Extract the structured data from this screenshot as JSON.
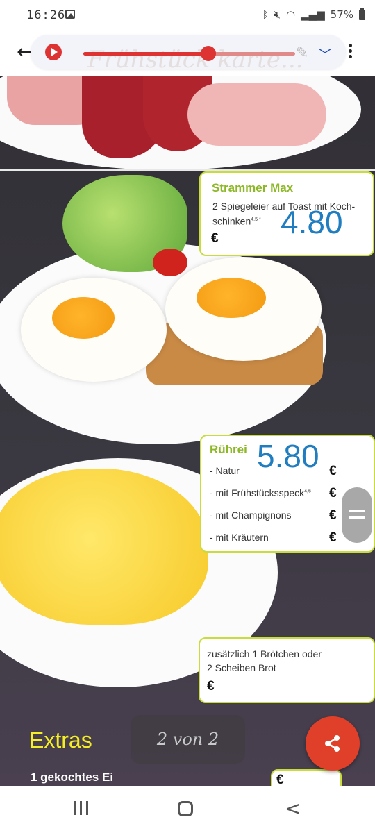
{
  "status_bar": {
    "time": "16:26",
    "battery_text": "57%",
    "icons": [
      "gallery-icon",
      "bluetooth-icon",
      "mute-icon",
      "lock-icon",
      "wifi-icon",
      "signal-icon",
      "battery-icon"
    ]
  },
  "toolbar": {
    "ghost_title": "Frühstück karte...",
    "audio_progress": 0.59,
    "icons": [
      "back-arrow-icon",
      "play-icon",
      "pencil-icon",
      "chevron-down-icon",
      "more-vert-icon"
    ],
    "accent_color": "#d33333"
  },
  "menu": {
    "strammer": {
      "title": "Strammer Max",
      "desc_line1": "2 Spiegeleier auf Toast mit Koch-",
      "desc_line2": "schinken",
      "sup": "4,5 *",
      "price": "4.80",
      "currency": "€"
    },
    "ruehrei": {
      "title": "Rührei",
      "price": "5.80",
      "currency": "€",
      "options": [
        {
          "label": "- Natur",
          "sup": "",
          "currency": "€"
        },
        {
          "label": "- mit Frühstücksspeck",
          "sup": "4,6",
          "currency": "€"
        },
        {
          "label": "- mit Champignons",
          "sup": "",
          "currency": "€"
        },
        {
          "label": "- mit Kräutern",
          "sup": "",
          "currency": "€"
        }
      ]
    },
    "zusatz": {
      "line1": "zusätzlich 1 Brötchen oder",
      "line2": "2 Scheiben Brot",
      "currency": "€"
    },
    "extras": {
      "title": "Extras",
      "item1": "1 gekochtes Ei",
      "currency": "€"
    },
    "title_color": "#8cb826",
    "price_color": "#1f7dc0"
  },
  "page_indicator": "2 von 2",
  "fab": {
    "icon": "share-icon",
    "color": "#e0402a"
  },
  "nav_bar": {
    "icons": [
      "recent-apps-icon",
      "home-icon",
      "back-icon"
    ]
  }
}
